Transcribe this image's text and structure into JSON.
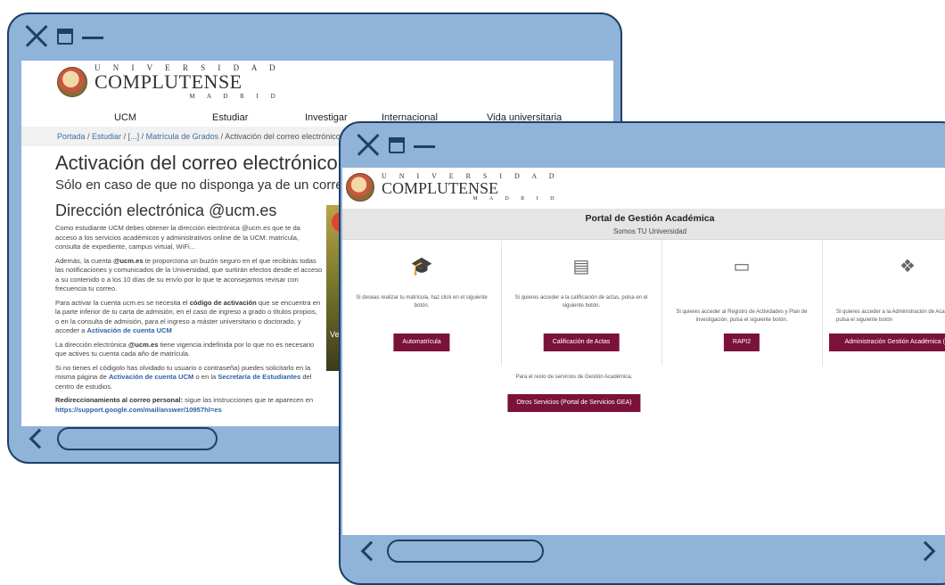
{
  "window1": {
    "logo": {
      "univ": "U N I V E R S I D A D",
      "name": "COMPLUTENSE",
      "city": "M A D R I D"
    },
    "nav": [
      "UCM",
      "Estudiar",
      "Investigar",
      "Internacional",
      "Vida universitaria"
    ],
    "breadcrumb": {
      "portada": "Portada",
      "estudiar": "Estudiar",
      "ellipsis": "[...]",
      "matricula": "Matrícula de Grados",
      "current": "Activación del correo electrónico institu",
      "sep": " / "
    },
    "title": "Activación del correo electrónico ins",
    "subtitle": "Sólo en caso de que no disponga ya de un correo uc",
    "section_title": "Dirección electrónica @ucm.es",
    "paragraphs": {
      "p1": "Como estudiante UCM debes obtener la dirección electrónica @ucm.es que te da acceso a los servicios académicos y administrativos online de la UCM: matrícula, consulta de expediente, campus virtual, WiFi...",
      "p2a": "Además, la cuenta ",
      "p2b": "@ucm.es",
      "p2c": " te proporciona un buzón seguro en el que recibirás todas las notificaciones y comunicados de la Universidad, que surtirán efectos desde el acceso a su contenido o a los 10 días de su envío por lo que te aconsejamos revisar con frecuencia tu correo.",
      "p3a": "Para activar la cuenta ucm.es se necesita el ",
      "p3b": "código de activación",
      "p3c": " que se encuentra  en la parte inferior de tu carta de admisión, en el caso de ingreso a grado o títulos propios, o en la consulta de admisión, para el ingreso a máster universitario o doctorado, y acceder a ",
      "p3d": "Activación  de cuenta UCM",
      "p4a": "La dirección electrónica ",
      "p4b": "@ucm.es",
      "p4c": " tiene vigencia indefinida por lo que no es necesario que actives tu cuenta cada año de matrícula.",
      "p5a": "Si no tienes el códigolo has olvidado tu usuario o contraseña) puedes solicitarlo en  la misma página de ",
      "p5b": "Activación de cuenta UCM",
      "p5c": " o en la ",
      "p5d": "Secretaría de Estudiantes",
      "p5e": " del centro de estudios.",
      "p6a": "Redireccionamiento al correo personal:",
      "p6b": " sigue las instrucciones que te aparecen en ",
      "p6c": "https://support.google.com/mail/answer/10957hl=es"
    },
    "video_caption": "Ver"
  },
  "window2": {
    "logo": {
      "univ": "U N I V E R S I D A D",
      "name": "COMPLUTENSE",
      "city": "M A D R I D"
    },
    "portal_title": "Portal de Gestión Académica",
    "portal_subtitle": "Somos TU Universidad",
    "columns": [
      {
        "icon": "graduation-cap-icon",
        "glyph": "🎓",
        "text": "Si deseas realizar tu matrícula, haz click en el siguiente botón.",
        "button": "Automatrícula"
      },
      {
        "icon": "document-icon",
        "glyph": "▤",
        "text": "Si quieres acceder a la calificación de actas, pulsa en el siguiente botón.",
        "button": "Calificación de Actas"
      },
      {
        "icon": "monitor-icon",
        "glyph": "▭",
        "text": "Si quieres acceder al Registro de Actividades y Plan de investigación, pulsa el siguiente botón.",
        "button": "RAPI2"
      },
      {
        "icon": "cubes-icon",
        "glyph": "❖",
        "text": "Si quieres acceder a la Administración de Académica, pulsa el siguiente botón",
        "button": "Administración Gestión Académica (Se"
      }
    ],
    "rest_note": "Para el resto de servicios de Gestión Académica.",
    "other_button": "Otros Servicios (Portal de Servicios GEA)"
  },
  "colors": {
    "frame": "#8fb3d9",
    "frame_border": "#1f3f66",
    "button": "#7a1239",
    "link": "#2c62a6"
  }
}
